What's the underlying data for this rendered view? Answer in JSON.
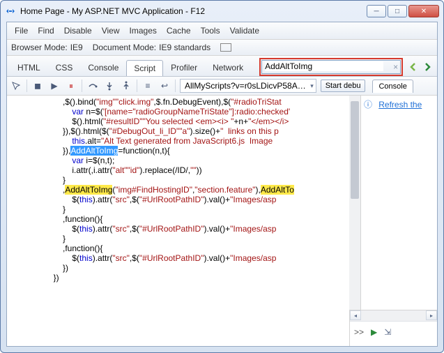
{
  "window": {
    "title": "Home Page - My ASP.NET MVC Application - F12"
  },
  "menubar": [
    "File",
    "Find",
    "Disable",
    "View",
    "Images",
    "Cache",
    "Tools",
    "Validate"
  ],
  "moderow": {
    "browser_label": "Browser Mode:",
    "browser_value": "IE9",
    "doc_label": "Document Mode:",
    "doc_value": "IE9 standards"
  },
  "tabs": {
    "items": [
      "HTML",
      "CSS",
      "Console",
      "Script",
      "Profiler",
      "Network"
    ],
    "active_index": 3
  },
  "search": {
    "value": "AddAltToImg",
    "clear": "×"
  },
  "toolbar": {
    "dropdown": "AllMyScripts?v=r0sLDicvP58A…",
    "start_debug": "Start debu"
  },
  "console_tab": "Console",
  "side_panel": {
    "refresh_text": "Refresh the"
  },
  "bottom_console": {
    "prompt": ">>"
  },
  "code": {
    "lines": [
      {
        "pre": "         ,$(",
        "str": "\"img\"",
        "mid": ").bind(",
        "str2": "\"click.img\"",
        "post": ",$.fn.DebugEvent),$(",
        "str3": "\"#radioTriStat"
      },
      {
        "pre": "             ",
        "kw": "var",
        "mid": " n=$(",
        "str": "'[name=\"radioGroupNameTriState\"]:radio:checked'"
      },
      {
        "pre": "             $(",
        "str": "\"#resultID\"",
        "mid": ").html(",
        "str2": "\"You selected <em><i> \"",
        "post": "+n+",
        "str3": "\"</em></i>"
      },
      {
        "pre": "         }),$(",
        "str": "\"#DebugOut_li_ID\"",
        "mid": ").html($(",
        "str2": "\"a\"",
        "post": ").size()+",
        "str3": "\"  links on this p"
      },
      {
        "pre": "             ",
        "kw": "this",
        "mid": ".alt=",
        "str": "\"Alt Text generated from JavaScript6.js  Image "
      },
      {
        "pre": "         }),",
        "hlblue": "AddAltToImg",
        "post": "=function(n,t){"
      },
      {
        "pre": "             ",
        "kw": "var",
        "post": " i=$(n,t);"
      },
      {
        "pre": "             i.attr(",
        "str": "\"alt\"",
        "mid": ",i.attr(",
        "str2": "\"id\"",
        "post": ").replace(/ID/,",
        "str3": "\"\"",
        "post2": "))"
      },
      {
        "pre": "         }"
      },
      {
        "pre": "         ,",
        "hlyel": "AddAltToImg",
        "mid": "(",
        "str": "\"img#FindHostingID\"",
        "mid2": ",",
        "str2": "\"section.feature\"",
        "post": "),",
        "hlyel2": "AddAltTo"
      },
      {
        "pre": "             $(",
        "kw": "this",
        "mid": ").attr(",
        "str": "\"src\"",
        "mid2": ",$(",
        "str2": "\"#UrlRootPathID\"",
        "post": ").val()+",
        "str3": "\"Images/asp"
      },
      {
        "pre": "         }"
      },
      {
        "pre": "         ,function(){"
      },
      {
        "pre": "             $(",
        "kw": "this",
        "mid": ").attr(",
        "str": "\"src\"",
        "mid2": ",$(",
        "str2": "\"#UrlRootPathID\"",
        "post": ").val()+",
        "str3": "\"Images/asp"
      },
      {
        "pre": "         }"
      },
      {
        "pre": "         ,function(){"
      },
      {
        "pre": "             $(",
        "kw": "this",
        "mid": ").attr(",
        "str": "\"src\"",
        "mid2": ",$(",
        "str2": "\"#UrlRootPathID\"",
        "post": ").val()+",
        "str3": "\"Images/asp"
      },
      {
        "pre": "         })"
      },
      {
        "pre": "     })"
      }
    ]
  }
}
